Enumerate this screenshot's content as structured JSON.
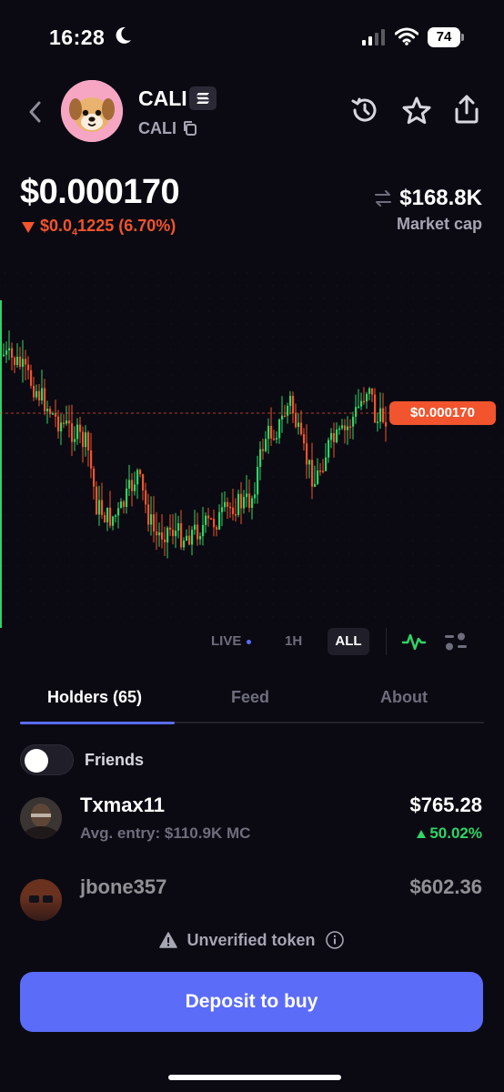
{
  "status_bar": {
    "time": "16:28",
    "battery": "74"
  },
  "token": {
    "name": "CALI",
    "symbol": "CALI"
  },
  "price": {
    "value": "$0.000170",
    "change_main": "$0.0",
    "change_sub": "4",
    "change_rest": "1225 (6.70%)",
    "market_cap": "$168.8K",
    "market_cap_label": "Market cap",
    "tag": "$0.000170"
  },
  "colors": {
    "accent": "#5b6cf9",
    "up": "#2fd565",
    "down": "#f2542d",
    "background": "#0b0a12"
  },
  "timeframes": {
    "live": "LIVE",
    "h1": "1H",
    "all": "ALL",
    "selected": "ALL"
  },
  "tabs": {
    "holders": "Holders (65)",
    "feed": "Feed",
    "about": "About"
  },
  "friends_label": "Friends",
  "holders": [
    {
      "name": "Txmax11",
      "sub": "Avg. entry: $110.9K MC",
      "value": "$765.28",
      "change": "50.02%"
    },
    {
      "name": "jbone357",
      "value": "$602.36"
    }
  ],
  "unverified_label": "Unverified token",
  "deposit_label": "Deposit to buy",
  "icons": [
    "back-chevron-icon",
    "solana-icon",
    "copy-icon",
    "history-icon",
    "star-icon",
    "share-icon",
    "swap-arrows-icon",
    "line-chart-icon",
    "candle-settings-icon",
    "warning-icon",
    "info-icon"
  ]
}
